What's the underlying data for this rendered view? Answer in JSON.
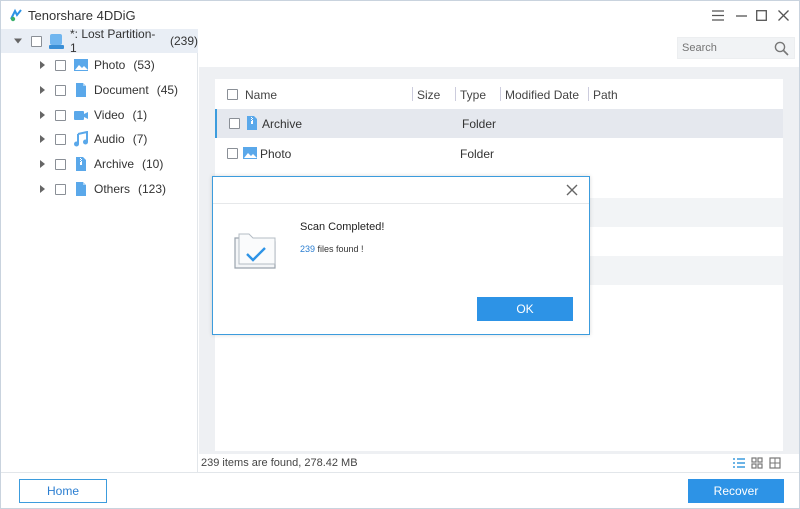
{
  "app": {
    "title": "Tenorshare 4DDiG"
  },
  "sidebar": {
    "root": {
      "label": "*: Lost Partition-1",
      "count": "(239)"
    },
    "items": [
      {
        "label": "Photo",
        "count": "(53)",
        "icon": "photo-icon"
      },
      {
        "label": "Document",
        "count": "(45)",
        "icon": "document-icon"
      },
      {
        "label": "Video",
        "count": "(1)",
        "icon": "video-icon"
      },
      {
        "label": "Audio",
        "count": "(7)",
        "icon": "audio-icon"
      },
      {
        "label": "Archive",
        "count": "(10)",
        "icon": "archive-icon"
      },
      {
        "label": "Others",
        "count": "(123)",
        "icon": "others-icon"
      }
    ]
  },
  "search": {
    "placeholder": "Search"
  },
  "table": {
    "columns": [
      "Name",
      "Size",
      "Type",
      "Modified Date",
      "Path"
    ],
    "rows": [
      {
        "name": "Archive",
        "type": "Folder",
        "icon": "archive-icon"
      },
      {
        "name": "Photo",
        "type": "Folder",
        "icon": "photo-icon"
      }
    ]
  },
  "status": {
    "text": "239 items are found, 278.42 MB"
  },
  "footer": {
    "home_label": "Home",
    "recover_label": "Recover"
  },
  "dialog": {
    "title": "Scan Completed!",
    "count": "239",
    "message_suffix": " files found !",
    "ok_label": "OK"
  },
  "colors": {
    "accent": "#2d93e6",
    "selection_bar": "#3c9cdd"
  }
}
